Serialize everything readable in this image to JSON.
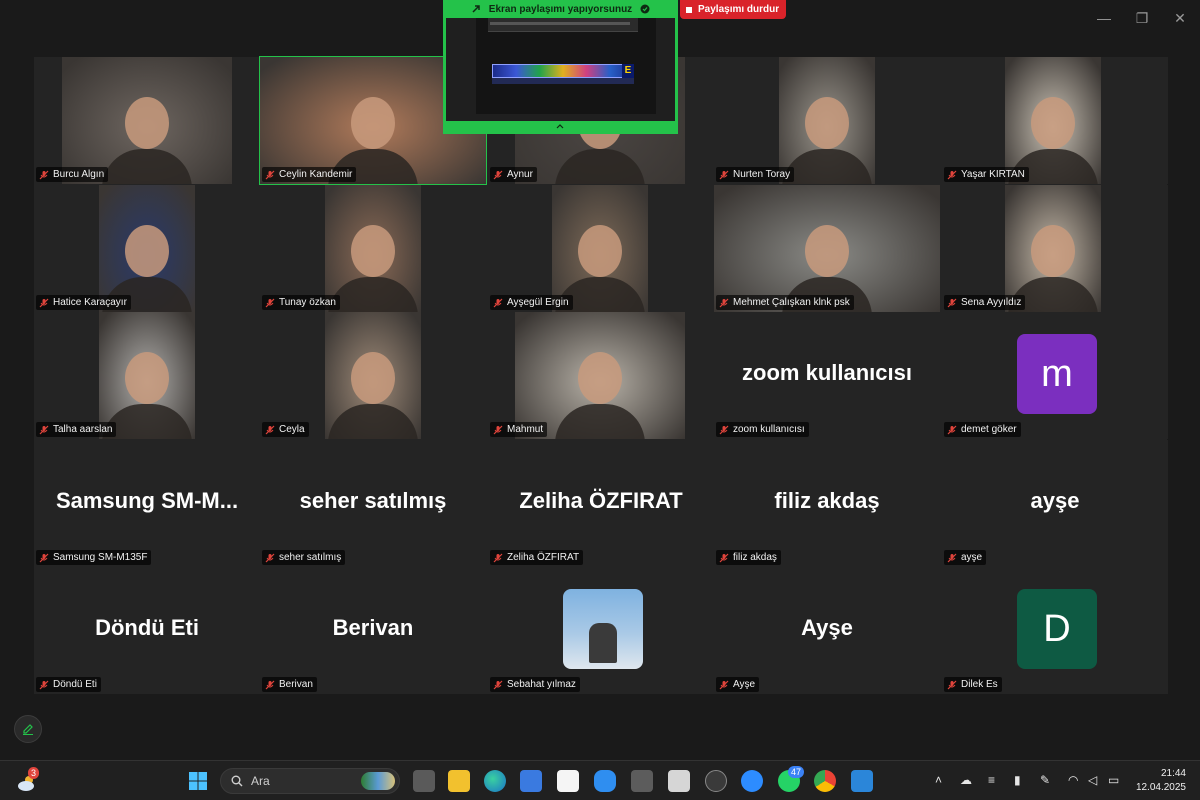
{
  "share": {
    "banner_text": "Ekran paylaşımı yapıyorsunuz",
    "stop_label": "Paylaşımı durdur"
  },
  "window": {
    "minimize": "—",
    "restore": "❐",
    "close": "✕"
  },
  "participants": [
    {
      "name": "Burcu Algın",
      "video": true,
      "tone": "#6e6660"
    },
    {
      "name": "Ceylin Kandemir",
      "video": true,
      "tone": "#b07a5a",
      "active": true
    },
    {
      "name": "Aynur",
      "video": true,
      "tone": "#4a4542"
    },
    {
      "name": "Nurten Toray",
      "video": true,
      "tone": "#9a958c"
    },
    {
      "name": "Yaşar KIRTAN",
      "video": true,
      "tone": "#c9c1b4"
    },
    {
      "name": "Hatice Karaçayır",
      "video": true,
      "tone": "#2a3a6a"
    },
    {
      "name": "Tunay özkan",
      "video": true,
      "tone": "#8a6a56"
    },
    {
      "name": "Ayşegül Ergin",
      "video": true,
      "tone": "#7d6a58"
    },
    {
      "name": "Mehmet Çalışkan klnk psk",
      "video": true,
      "tone": "#8a8a86"
    },
    {
      "name": "Sena Ayyıldız",
      "video": true,
      "tone": "#c4b8a8"
    },
    {
      "name": "Talha aarslan",
      "video": true,
      "tone": "#b0aeab"
    },
    {
      "name": "Ceyla",
      "video": true,
      "tone": "#9e8a78"
    },
    {
      "name": "Mahmut",
      "video": true,
      "tone": "#b8b2a8"
    },
    {
      "name": "zoom kullanıcısı",
      "display": "zoom kullanıcısı"
    },
    {
      "name": "demet göker",
      "avatar_letter": "m",
      "avatar_color": "#7b2fbf"
    },
    {
      "name": "Samsung SM-M135F",
      "display": "Samsung  SM-M..."
    },
    {
      "name": "seher satılmış",
      "display": "seher satılmış"
    },
    {
      "name": "Zeliha ÖZFIRAT",
      "display": "Zeliha ÖZFIRAT"
    },
    {
      "name": "filiz akdaş",
      "display": "filiz akdaş"
    },
    {
      "name": "ayşe",
      "display": "ayşe"
    },
    {
      "name": "Döndü Eti",
      "display": "Döndü Eti"
    },
    {
      "name": "Berivan",
      "display": "Berivan"
    },
    {
      "name": "Sebahat yılmaz",
      "photo": true
    },
    {
      "name": "Ayşe",
      "display": "Ayşe"
    },
    {
      "name": "Dilek Es",
      "avatar_letter": "D",
      "avatar_color": "#0e5a43"
    }
  ],
  "taskbar": {
    "search_label": "Ara",
    "weather_badge": "3",
    "whatsapp_badge": "47",
    "time": "21:44",
    "date": "12.04.2025"
  },
  "colors": {
    "share_green": "#24c24a",
    "stop_red": "#d9232a",
    "muted_red": "#e0443c"
  }
}
